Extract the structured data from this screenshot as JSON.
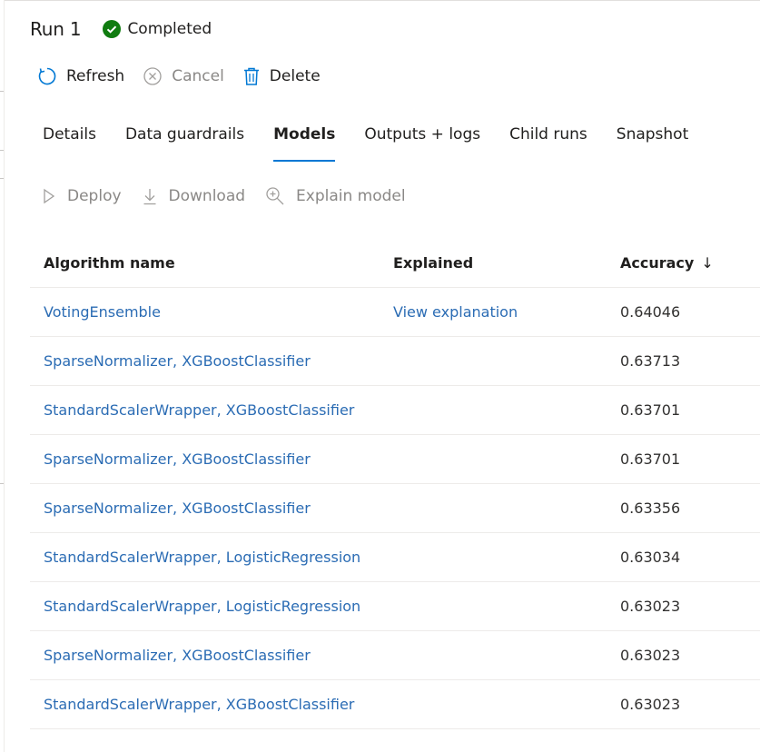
{
  "header": {
    "title": "Run 1",
    "status": "Completed",
    "status_color": "#107c10"
  },
  "commands": {
    "refresh": "Refresh",
    "cancel": "Cancel",
    "delete": "Delete"
  },
  "tabs": [
    {
      "label": "Details",
      "active": false
    },
    {
      "label": "Data guardrails",
      "active": false
    },
    {
      "label": "Models",
      "active": true
    },
    {
      "label": "Outputs + logs",
      "active": false
    },
    {
      "label": "Child runs",
      "active": false
    },
    {
      "label": "Snapshot",
      "active": false
    }
  ],
  "model_commands": {
    "deploy": "Deploy",
    "download": "Download",
    "explain": "Explain model"
  },
  "table": {
    "columns": {
      "algorithm": "Algorithm name",
      "explained": "Explained",
      "accuracy": "Accuracy",
      "sort_indicator": "↓"
    },
    "rows": [
      {
        "algorithm": "VotingEnsemble",
        "explained": "View explanation",
        "accuracy": "0.64046"
      },
      {
        "algorithm": "SparseNormalizer, XGBoostClassifier",
        "explained": "",
        "accuracy": "0.63713"
      },
      {
        "algorithm": "StandardScalerWrapper, XGBoostClassifier",
        "explained": "",
        "accuracy": "0.63701"
      },
      {
        "algorithm": "SparseNormalizer, XGBoostClassifier",
        "explained": "",
        "accuracy": "0.63701"
      },
      {
        "algorithm": "SparseNormalizer, XGBoostClassifier",
        "explained": "",
        "accuracy": "0.63356"
      },
      {
        "algorithm": "StandardScalerWrapper, LogisticRegression",
        "explained": "",
        "accuracy": "0.63034"
      },
      {
        "algorithm": "StandardScalerWrapper, LogisticRegression",
        "explained": "",
        "accuracy": "0.63023"
      },
      {
        "algorithm": "SparseNormalizer, XGBoostClassifier",
        "explained": "",
        "accuracy": "0.63023"
      },
      {
        "algorithm": "StandardScalerWrapper, XGBoostClassifier",
        "explained": "",
        "accuracy": "0.63023"
      }
    ]
  },
  "icons": {
    "status": "checkmark-circle-icon",
    "refresh": "refresh-icon",
    "cancel": "cancel-icon",
    "delete": "trash-icon",
    "deploy": "play-icon",
    "download": "download-icon",
    "explain": "zoom-in-icon"
  }
}
